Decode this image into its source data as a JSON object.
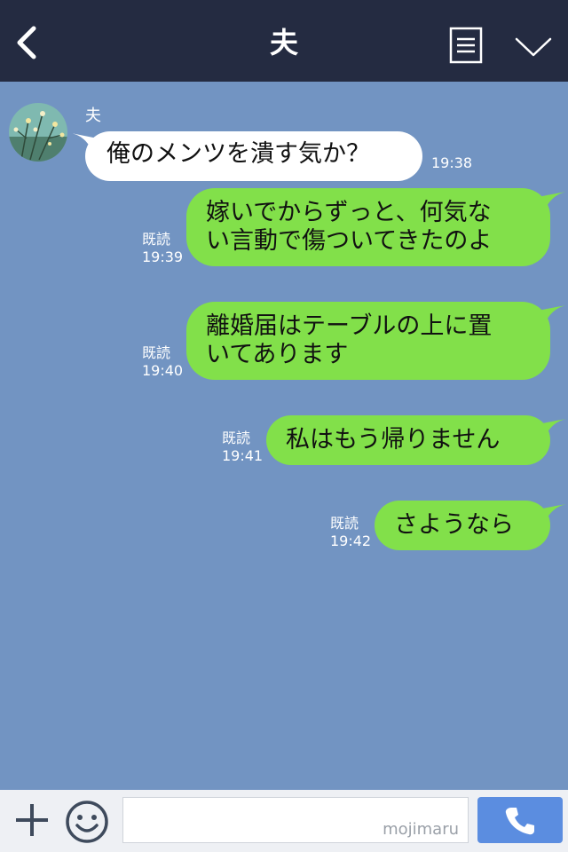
{
  "header": {
    "title": "夫",
    "back_icon": "chevron-left-icon",
    "notes_icon": "notes-icon",
    "menu_icon": "chevron-down-icon"
  },
  "chat": {
    "incoming": {
      "sender": "夫",
      "text": "俺のメンツを潰す気か？",
      "time": "19:38"
    },
    "outgoing": [
      {
        "lines": [
          "嫁いでからずっと、何気な",
          "い言動で傷ついてきたのよ"
        ],
        "read": "既読",
        "time": "19:39"
      },
      {
        "lines": [
          "離婚届はテーブルの上に置",
          "いてあります"
        ],
        "read": "既読",
        "time": "19:40"
      },
      {
        "lines": [
          "私はもう帰りません"
        ],
        "read": "既読",
        "time": "19:41"
      },
      {
        "lines": [
          "さようなら"
        ],
        "read": "既読",
        "time": "19:42"
      }
    ]
  },
  "footer": {
    "input_value": "",
    "watermark": "mojimaru",
    "plus_icon": "plus-icon",
    "emoji_icon": "smiley-icon",
    "call_icon": "phone-icon"
  },
  "colors": {
    "header_bg": "#242b41",
    "chat_bg": "#7294c2",
    "outgoing_bubble": "#82e04a",
    "incoming_bubble": "#ffffff",
    "call_button": "#5b8de0"
  }
}
